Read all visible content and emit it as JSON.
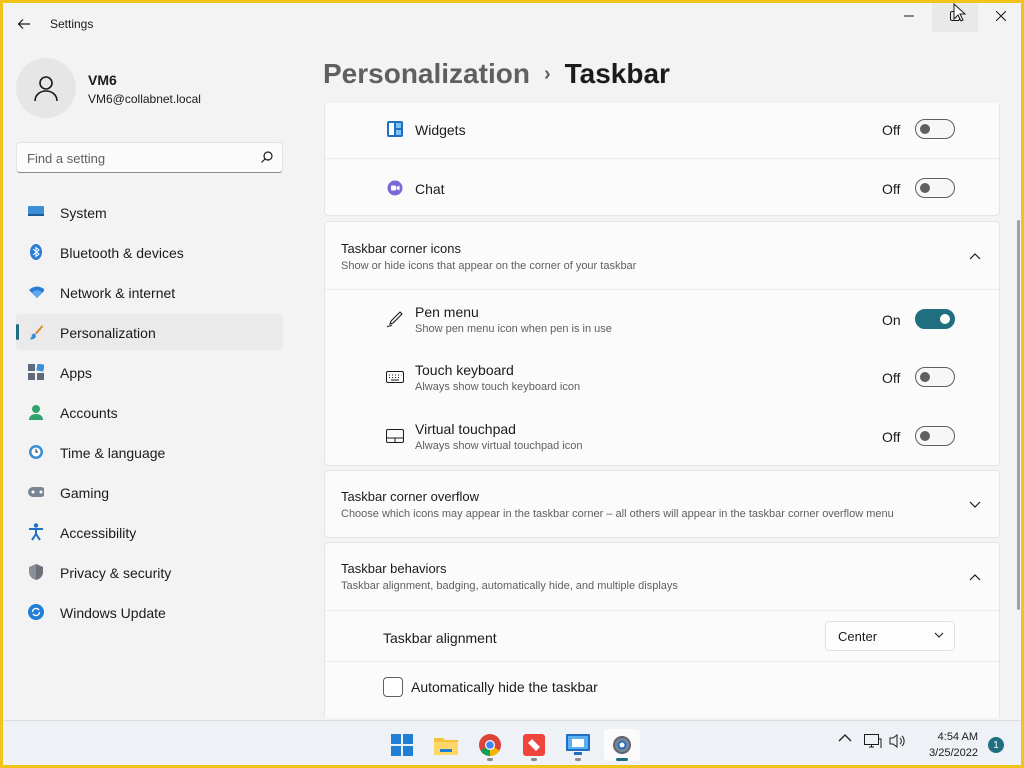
{
  "window": {
    "title": "Settings"
  },
  "profile": {
    "name": "VM6",
    "email": "VM6@collabnet.local"
  },
  "search": {
    "placeholder": "Find a setting"
  },
  "sidebar": {
    "items": [
      {
        "label": "System",
        "icon": "monitor-icon"
      },
      {
        "label": "Bluetooth & devices",
        "icon": "bluetooth-icon"
      },
      {
        "label": "Network & internet",
        "icon": "wifi-icon"
      },
      {
        "label": "Personalization",
        "icon": "brush-icon",
        "active": true
      },
      {
        "label": "Apps",
        "icon": "apps-icon"
      },
      {
        "label": "Accounts",
        "icon": "person-icon"
      },
      {
        "label": "Time & language",
        "icon": "globe-clock-icon"
      },
      {
        "label": "Gaming",
        "icon": "gamepad-icon"
      },
      {
        "label": "Accessibility",
        "icon": "accessibility-icon"
      },
      {
        "label": "Privacy & security",
        "icon": "shield-icon"
      },
      {
        "label": "Windows Update",
        "icon": "update-icon"
      }
    ]
  },
  "breadcrumb": {
    "parent": "Personalization",
    "separator": "›",
    "current": "Taskbar"
  },
  "taskbar_items": {
    "widgets": {
      "label": "Widgets",
      "state": "Off",
      "on": false
    },
    "chat": {
      "label": "Chat",
      "state": "Off",
      "on": false
    }
  },
  "corner_icons": {
    "title": "Taskbar corner icons",
    "subtitle": "Show or hide icons that appear on the corner of your taskbar",
    "pen_menu": {
      "label": "Pen menu",
      "sub": "Show pen menu icon when pen is in use",
      "state": "On",
      "on": true
    },
    "touch_keyboard": {
      "label": "Touch keyboard",
      "sub": "Always show touch keyboard icon",
      "state": "Off",
      "on": false
    },
    "virtual_touchpad": {
      "label": "Virtual touchpad",
      "sub": "Always show virtual touchpad icon",
      "state": "Off",
      "on": false
    }
  },
  "corner_overflow": {
    "title": "Taskbar corner overflow",
    "subtitle": "Choose which icons may appear in the taskbar corner – all others will appear in the taskbar corner overflow menu"
  },
  "behaviors": {
    "title": "Taskbar behaviors",
    "subtitle": "Taskbar alignment, badging, automatically hide, and multiple displays",
    "alignment_label": "Taskbar alignment",
    "alignment_value": "Center",
    "autohide_label": "Automatically hide the taskbar",
    "autohide_checked": false
  },
  "system_taskbar": {
    "time": "4:54 AM",
    "date": "3/25/2022",
    "notifications": "1",
    "apps": [
      "windows-start-icon",
      "file-explorer-icon",
      "chrome-icon",
      "anydesk-icon",
      "remote-desktop-icon",
      "settings-icon"
    ]
  },
  "colors": {
    "accent": "#1f6f80",
    "frame": "#f0c419"
  }
}
